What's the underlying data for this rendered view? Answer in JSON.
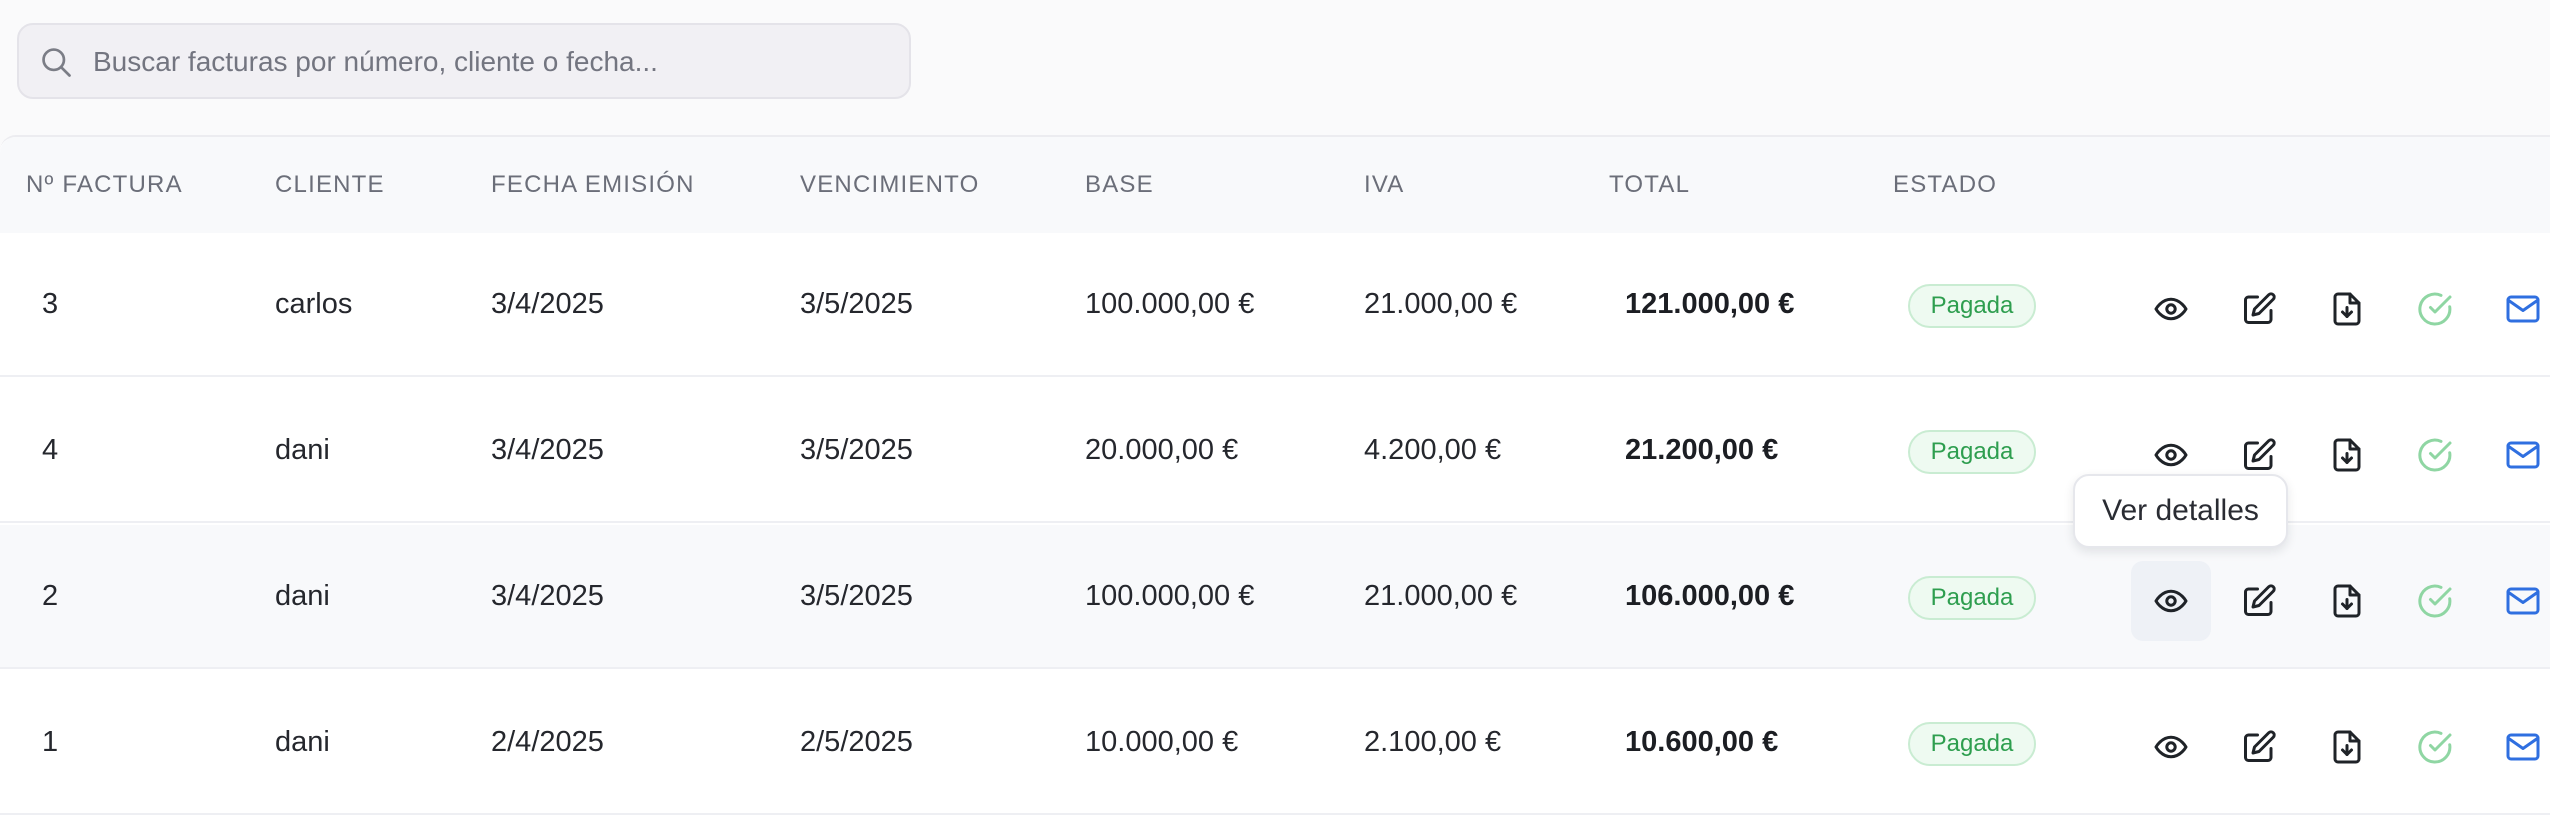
{
  "search": {
    "placeholder": "Buscar facturas por número, cliente o fecha...",
    "value": ""
  },
  "table": {
    "headers": [
      "Nº FACTURA",
      "CLIENTE",
      "FECHA EMISIÓN",
      "VENCIMIENTO",
      "BASE",
      "IVA",
      "TOTAL",
      "ESTADO"
    ],
    "rows": [
      {
        "numero": "3",
        "cliente": "carlos",
        "fecha_emision": "3/4/2025",
        "vencimiento": "3/5/2025",
        "base": "100.000,00 €",
        "iva": "21.000,00 €",
        "total": "121.000,00 €",
        "estado": "Pagada"
      },
      {
        "numero": "4",
        "cliente": "dani",
        "fecha_emision": "3/4/2025",
        "vencimiento": "3/5/2025",
        "base": "20.000,00 €",
        "iva": "4.200,00 €",
        "total": "21.200,00 €",
        "estado": "Pagada"
      },
      {
        "numero": "2",
        "cliente": "dani",
        "fecha_emision": "3/4/2025",
        "vencimiento": "3/5/2025",
        "base": "100.000,00 €",
        "iva": "21.000,00 €",
        "total": "106.000,00 €",
        "estado": "Pagada"
      },
      {
        "numero": "1",
        "cliente": "dani",
        "fecha_emision": "2/4/2025",
        "vencimiento": "2/5/2025",
        "base": "10.000,00 €",
        "iva": "2.100,00 €",
        "total": "10.600,00 €",
        "estado": "Pagada"
      }
    ],
    "actions": [
      "eye-icon",
      "edit-icon",
      "file-download-icon",
      "check-circle-icon",
      "mail-icon"
    ]
  },
  "tooltip": {
    "text": "Ver detalles"
  },
  "colors": {
    "status_paid_text": "#2e9e4f",
    "status_paid_bg": "#eefaf1",
    "check_icon": "#8fd6a3",
    "mail_icon": "#2f6fe0"
  }
}
